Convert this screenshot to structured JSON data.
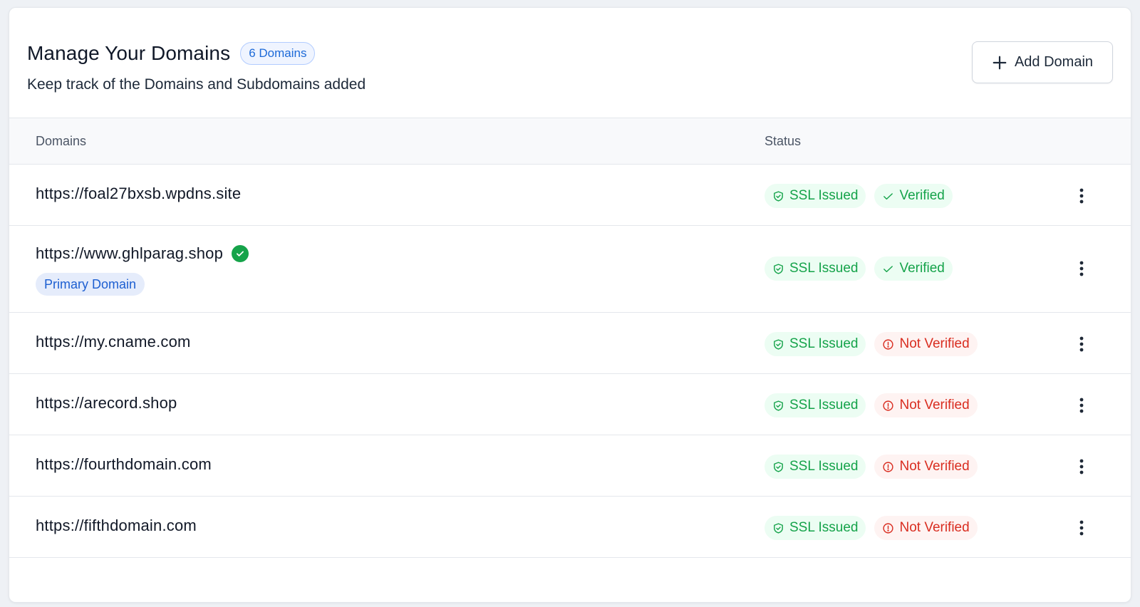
{
  "header": {
    "title": "Manage Your Domains",
    "count_badge": "6 Domains",
    "subtitle": "Keep track of the Domains and Subdomains added",
    "add_button_label": "Add Domain"
  },
  "table": {
    "columns": [
      "Domains",
      "Status"
    ],
    "rows": [
      {
        "url": "https://foal27bxsb.wpdns.site",
        "ssl": "SSL Issued",
        "verification": "Verified",
        "verified": true,
        "primary": false
      },
      {
        "url": "https://www.ghlparag.shop",
        "ssl": "SSL Issued",
        "verification": "Verified",
        "verified": true,
        "primary": true,
        "primary_label": "Primary Domain"
      },
      {
        "url": "https://my.cname.com",
        "ssl": "SSL Issued",
        "verification": "Not Verified",
        "verified": false,
        "primary": false
      },
      {
        "url": "https://arecord.shop",
        "ssl": "SSL Issued",
        "verification": "Not Verified",
        "verified": false,
        "primary": false
      },
      {
        "url": "https://fourthdomain.com",
        "ssl": "SSL Issued",
        "verification": "Not Verified",
        "verified": false,
        "primary": false
      },
      {
        "url": "https://fifthdomain.com",
        "ssl": "SSL Issued",
        "verification": "Not Verified",
        "verified": false,
        "primary": false
      }
    ]
  },
  "colors": {
    "success": "#15a34a",
    "success_bg": "#ecfdf3",
    "danger": "#d92d20",
    "danger_bg": "#fef3f2",
    "primary": "#1d5fd1"
  },
  "icons": {
    "add": "plus-icon",
    "ssl": "shield-check-icon",
    "verified": "check-icon",
    "not_verified": "alert-circle-icon",
    "primary_verified": "check-circle-icon",
    "row_menu": "more-vertical-icon"
  }
}
